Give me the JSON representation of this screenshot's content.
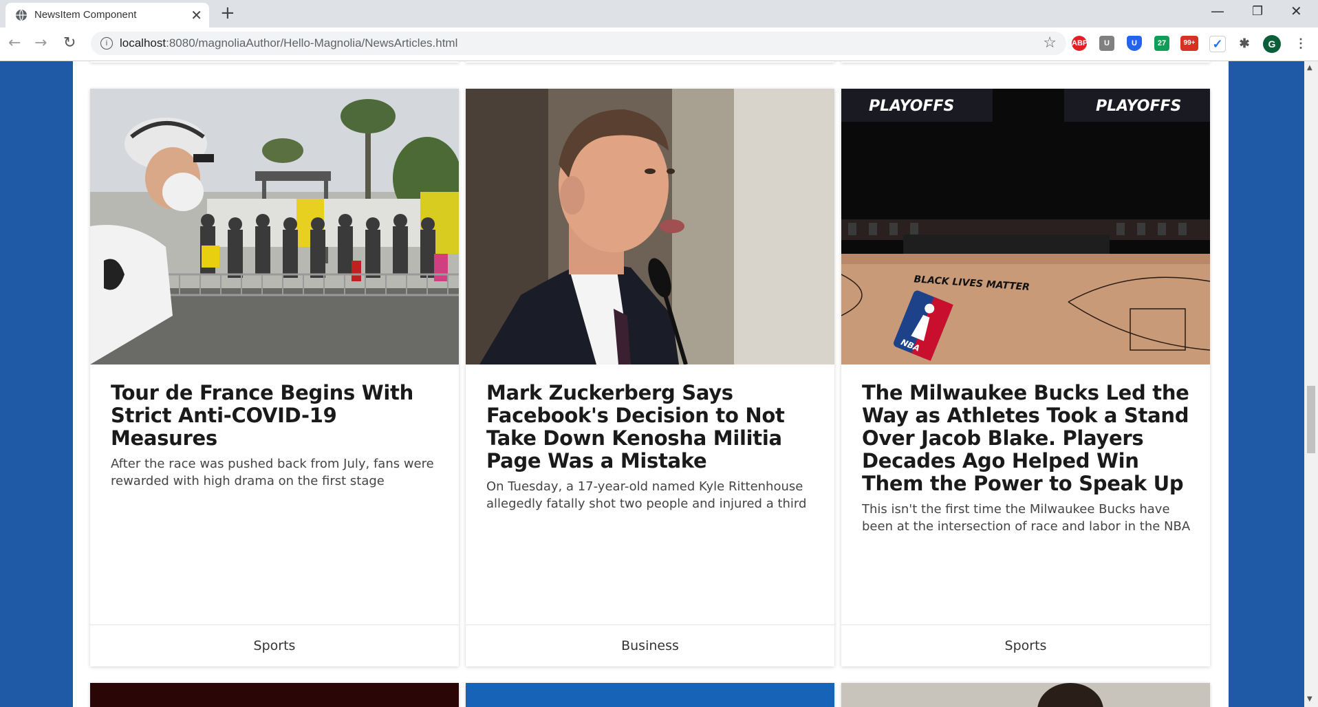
{
  "browser": {
    "tab_title": "NewsItem Component",
    "url_host": "localhost",
    "url_path": ":8080/magnoliaAuthor/Hello-Magnolia/NewsArticles.html",
    "extensions": [
      {
        "name": "adblock-plus",
        "label": "ABP",
        "color": "#e31e24"
      },
      {
        "name": "ublock",
        "label": "U",
        "color": "#808080"
      },
      {
        "name": "shield",
        "label": "U",
        "color": "#2463eb"
      },
      {
        "name": "calendar",
        "label": "27",
        "color": "#0f9d58"
      },
      {
        "name": "mail",
        "label": "99+",
        "color": "#d93025"
      },
      {
        "name": "checklist",
        "label": "✓",
        "color": "#1a73e8"
      }
    ],
    "profile_initial": "G"
  },
  "cards": [
    {
      "title": "Tour de France Begins With Strict Anti-COVID-19 Measures",
      "description": "After the race was pushed back from July, fans were rewarded with high drama on the first stage",
      "category": "Sports"
    },
    {
      "title": "Mark Zuckerberg Says Facebook's Decision to Not Take Down Kenosha Militia Page Was a Mistake",
      "description": "On Tuesday, a 17-year-old named Kyle Rittenhouse allegedly fatally shot two people and injured a third",
      "category": "Business"
    },
    {
      "title": "The Milwaukee Bucks Led the Way as Athletes Took a Stand Over Jacob Blake. Players Decades Ago Helped Win Them the Power to Speak Up",
      "description": "This isn't the first time the Milwaukee Bucks have been at the intersection of race and labor in the NBA",
      "category": "Sports"
    }
  ],
  "photo_text": {
    "playoffs_left": "PLAYOFFS",
    "playoffs_right": "PLAYOFFS",
    "court_text": "BLACK LIVES MATTER",
    "nba_logo": "NBA"
  }
}
